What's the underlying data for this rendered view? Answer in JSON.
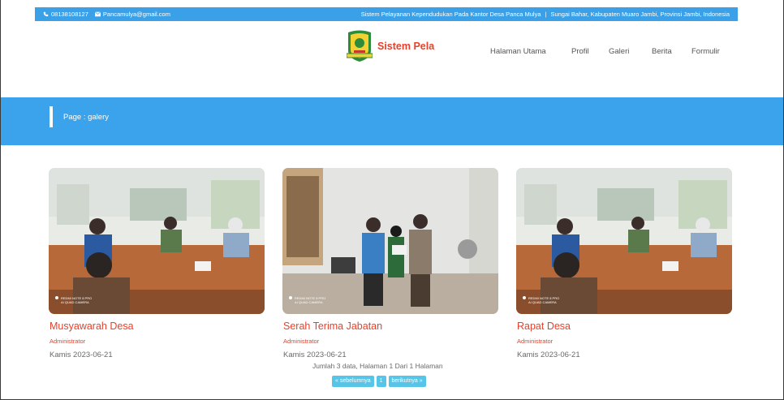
{
  "topbar": {
    "phone": "08138108127",
    "email": "Pancamulya@gmail.com",
    "tagline": "Sistem Pelayanan Kependudukan Pada Kantor Desa Panca Mulya",
    "separator": "|",
    "address": "Sungai Bahar, Kabupaten Muaro Jambi, Provinsi Jambi, Indonesia"
  },
  "brand": "Sistem Pelayanan",
  "nav": [
    "Halaman Utama",
    "Profil",
    "Galeri",
    "Berita",
    "Formulir"
  ],
  "page_title": "Page : galery",
  "gallery": [
    {
      "title": "Musyawarah Desa",
      "author": "Administrator",
      "date": "Kamis 2023-06-21",
      "watermark1": "REDMI NOTE 8 PRO",
      "watermark2": "AI QUAD CAMERA"
    },
    {
      "title": "Serah Terima Jabatan",
      "author": "Administrator",
      "date": "Kamis 2023-06-21",
      "watermark1": "REDMI NOTE 8 PRO",
      "watermark2": "AI QUAD CAMERA"
    },
    {
      "title": "Rapat Desa",
      "author": "Administrator",
      "date": "Kamis 2023-06-21",
      "watermark1": "REDMI NOTE 8 PRO",
      "watermark2": "AI QUAD CAMERA"
    }
  ],
  "summary": "Jumlah 3 data, Halaman 1 Dari 1 Halaman",
  "pager": {
    "prev": "« sebelumnya",
    "page": "1",
    "next": "berikutnya »"
  },
  "colors": {
    "primary": "#3ba2ec",
    "accent": "#e8402a",
    "pager": "#56c5e8"
  }
}
